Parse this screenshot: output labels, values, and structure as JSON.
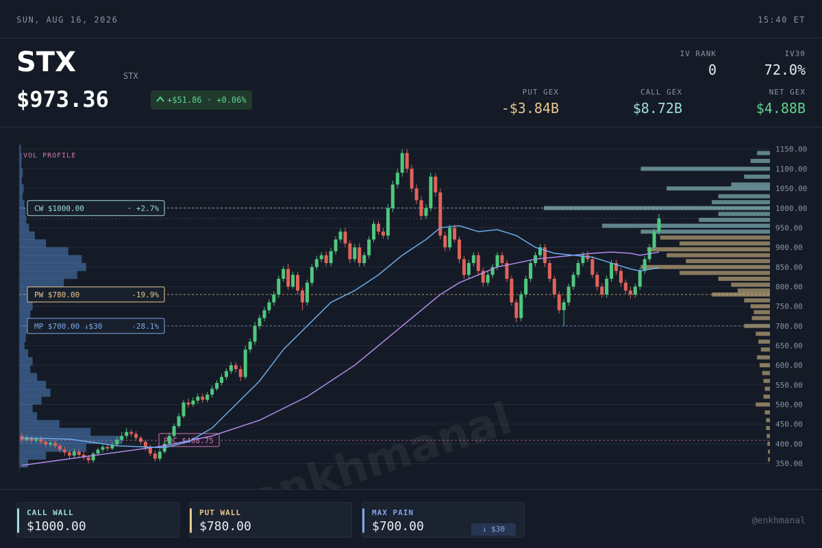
{
  "topbar": {
    "date": "SUN, AUG 16, 2026",
    "time": "15:40 ET"
  },
  "header": {
    "ticker": "STX",
    "ticker_small": "STX",
    "price": "$973.36",
    "change": "+$51.86 · +0.06%",
    "iv_rank_label": "IV RANK",
    "iv_rank_value": "0",
    "iv30_label": "IV30",
    "iv30_value": "72.0%",
    "put_gex_label": "PUT GEX",
    "put_gex_value": "-$3.84B",
    "call_gex_label": "CALL GEX",
    "call_gex_value": "$8.72B",
    "net_gex_label": "NET GEX",
    "net_gex_value": "$4.88B"
  },
  "colors": {
    "up": "#4fc77e",
    "down": "#e0625a",
    "call": "#9fdde0",
    "put": "#e7c98d",
    "maxpain": "#7fa7e8",
    "poc": "#d179b8",
    "ma_fast": "#6aaef0",
    "ma_slow": "#b38df0"
  },
  "chart_data": {
    "type": "candlestick",
    "title": "",
    "vol_profile_label": "VOL PROFILE",
    "watermark": "@enkhmanal",
    "ylim": [
      330,
      1160
    ],
    "y_ticks": [
      "1150.00",
      "1100.00",
      "1050.00",
      "1000.00",
      "950.00",
      "900.00",
      "850.00",
      "800.00",
      "750.00",
      "700.00",
      "650.00",
      "600.00",
      "550.00",
      "500.00",
      "450.00",
      "400.00",
      "350.00"
    ],
    "levels": [
      {
        "name": "CW",
        "label": "CW $1000.00",
        "pct": "· +2.7%",
        "value": 1000,
        "color_key": "call"
      },
      {
        "name": "PW",
        "label": "PW $780.00",
        "pct": "-19.9%",
        "value": 780,
        "color_key": "put"
      },
      {
        "name": "MP",
        "label": "MP $700.00 ↓$30",
        "pct": "-28.1%",
        "value": 700,
        "color_key": "maxpain"
      },
      {
        "name": "POC",
        "label": "POC $408.75",
        "pct": "",
        "value": 408.75,
        "color_key": "poc"
      }
    ],
    "candles": [
      [
        420,
        410,
        428,
        402
      ],
      [
        410,
        415,
        422,
        404
      ],
      [
        415,
        408,
        420,
        400
      ],
      [
        408,
        412,
        418,
        402
      ],
      [
        412,
        405,
        420,
        398
      ],
      [
        405,
        398,
        410,
        390
      ],
      [
        398,
        402,
        408,
        392
      ],
      [
        402,
        395,
        410,
        388
      ],
      [
        395,
        385,
        400,
        378
      ],
      [
        385,
        378,
        392,
        370
      ],
      [
        378,
        370,
        385,
        362
      ],
      [
        370,
        380,
        388,
        365
      ],
      [
        380,
        372,
        386,
        366
      ],
      [
        372,
        365,
        380,
        358
      ],
      [
        365,
        358,
        372,
        350
      ],
      [
        358,
        375,
        380,
        352
      ],
      [
        375,
        385,
        390,
        370
      ],
      [
        385,
        392,
        398,
        378
      ],
      [
        392,
        388,
        400,
        382
      ],
      [
        388,
        398,
        405,
        384
      ],
      [
        398,
        410,
        418,
        392
      ],
      [
        410,
        420,
        430,
        404
      ],
      [
        420,
        430,
        440,
        412
      ],
      [
        430,
        425,
        436,
        418
      ],
      [
        425,
        415,
        432,
        408
      ],
      [
        415,
        405,
        420,
        398
      ],
      [
        405,
        390,
        410,
        382
      ],
      [
        390,
        375,
        398,
        368
      ],
      [
        375,
        362,
        382,
        355
      ],
      [
        362,
        380,
        388,
        356
      ],
      [
        380,
        400,
        408,
        375
      ],
      [
        400,
        420,
        428,
        395
      ],
      [
        420,
        445,
        452,
        415
      ],
      [
        445,
        470,
        478,
        440
      ],
      [
        470,
        505,
        512,
        465
      ],
      [
        505,
        500,
        515,
        492
      ],
      [
        500,
        510,
        518,
        494
      ],
      [
        510,
        520,
        528,
        502
      ],
      [
        520,
        512,
        528,
        505
      ],
      [
        512,
        525,
        532,
        506
      ],
      [
        525,
        540,
        548,
        518
      ],
      [
        540,
        555,
        562,
        535
      ],
      [
        555,
        570,
        578,
        548
      ],
      [
        570,
        585,
        592,
        562
      ],
      [
        585,
        600,
        608,
        578
      ],
      [
        600,
        590,
        608,
        582
      ],
      [
        590,
        570,
        598,
        560
      ],
      [
        570,
        640,
        650,
        565
      ],
      [
        640,
        660,
        668,
        632
      ],
      [
        660,
        700,
        710,
        652
      ],
      [
        700,
        720,
        728,
        692
      ],
      [
        720,
        740,
        748,
        712
      ],
      [
        740,
        760,
        768,
        732
      ],
      [
        760,
        780,
        788,
        752
      ],
      [
        780,
        820,
        828,
        772
      ],
      [
        820,
        845,
        852,
        812
      ],
      [
        845,
        800,
        858,
        792
      ],
      [
        800,
        830,
        838,
        795
      ],
      [
        830,
        790,
        838,
        780
      ],
      [
        790,
        760,
        798,
        740
      ],
      [
        760,
        810,
        818,
        752
      ],
      [
        810,
        850,
        858,
        802
      ],
      [
        850,
        870,
        878,
        842
      ],
      [
        870,
        880,
        888,
        862
      ],
      [
        880,
        860,
        890,
        852
      ],
      [
        860,
        890,
        898,
        852
      ],
      [
        890,
        920,
        928,
        882
      ],
      [
        920,
        940,
        948,
        912
      ],
      [
        940,
        910,
        950,
        900
      ],
      [
        910,
        870,
        918,
        860
      ],
      [
        870,
        900,
        908,
        862
      ],
      [
        900,
        860,
        910,
        850
      ],
      [
        860,
        880,
        888,
        852
      ],
      [
        880,
        920,
        928,
        872
      ],
      [
        920,
        960,
        968,
        912
      ],
      [
        960,
        940,
        968,
        932
      ],
      [
        940,
        930,
        950,
        922
      ],
      [
        930,
        1000,
        1010,
        920
      ],
      [
        1000,
        1060,
        1070,
        990
      ],
      [
        1060,
        1090,
        1100,
        1050
      ],
      [
        1090,
        1140,
        1150,
        1080
      ],
      [
        1140,
        1100,
        1150,
        1090
      ],
      [
        1100,
        1050,
        1110,
        1040
      ],
      [
        1050,
        1020,
        1060,
        1010
      ],
      [
        1020,
        980,
        1030,
        970
      ],
      [
        980,
        1000,
        1010,
        972
      ],
      [
        1000,
        1080,
        1090,
        992
      ],
      [
        1080,
        1040,
        1088,
        1030
      ],
      [
        1040,
        930,
        1050,
        920
      ],
      [
        930,
        900,
        940,
        890
      ],
      [
        900,
        950,
        958,
        892
      ],
      [
        950,
        920,
        958,
        912
      ],
      [
        920,
        870,
        928,
        860
      ],
      [
        870,
        830,
        878,
        820
      ],
      [
        830,
        860,
        868,
        822
      ],
      [
        860,
        880,
        888,
        852
      ],
      [
        880,
        840,
        888,
        832
      ],
      [
        840,
        810,
        848,
        800
      ],
      [
        810,
        830,
        838,
        802
      ],
      [
        830,
        850,
        858,
        822
      ],
      [
        850,
        880,
        888,
        842
      ],
      [
        880,
        860,
        888,
        852
      ],
      [
        860,
        820,
        868,
        812
      ],
      [
        820,
        760,
        828,
        752
      ],
      [
        760,
        720,
        768,
        710
      ],
      [
        720,
        780,
        788,
        712
      ],
      [
        780,
        820,
        828,
        772
      ],
      [
        820,
        860,
        868,
        812
      ],
      [
        860,
        880,
        888,
        852
      ],
      [
        880,
        900,
        908,
        872
      ],
      [
        900,
        860,
        908,
        850
      ],
      [
        860,
        820,
        868,
        812
      ],
      [
        820,
        780,
        828,
        772
      ],
      [
        780,
        740,
        788,
        732
      ],
      [
        740,
        760,
        768,
        700
      ],
      [
        760,
        800,
        808,
        752
      ],
      [
        800,
        830,
        838,
        792
      ],
      [
        830,
        860,
        868,
        822
      ],
      [
        860,
        880,
        888,
        852
      ],
      [
        880,
        870,
        890,
        862
      ],
      [
        870,
        830,
        878,
        822
      ],
      [
        830,
        800,
        838,
        790
      ],
      [
        800,
        780,
        808,
        772
      ],
      [
        780,
        820,
        828,
        772
      ],
      [
        820,
        860,
        868,
        812
      ],
      [
        860,
        840,
        868,
        830
      ],
      [
        840,
        810,
        848,
        800
      ],
      [
        810,
        790,
        818,
        782
      ],
      [
        790,
        780,
        800,
        770
      ],
      [
        780,
        800,
        808,
        772
      ],
      [
        800,
        840,
        848,
        792
      ],
      [
        840,
        870,
        878,
        832
      ],
      [
        870,
        900,
        908,
        862
      ],
      [
        900,
        940,
        948,
        892
      ],
      [
        940,
        973.36,
        985,
        932
      ]
    ],
    "ma_fast": [
      [
        0,
        415
      ],
      [
        10,
        412
      ],
      [
        20,
        395
      ],
      [
        30,
        390
      ],
      [
        35,
        405
      ],
      [
        40,
        440
      ],
      [
        45,
        500
      ],
      [
        50,
        560
      ],
      [
        55,
        640
      ],
      [
        60,
        700
      ],
      [
        65,
        760
      ],
      [
        70,
        790
      ],
      [
        75,
        830
      ],
      [
        80,
        880
      ],
      [
        85,
        920
      ],
      [
        88,
        950
      ],
      [
        92,
        955
      ],
      [
        96,
        940
      ],
      [
        100,
        945
      ],
      [
        104,
        930
      ],
      [
        108,
        900
      ],
      [
        112,
        885
      ],
      [
        116,
        880
      ],
      [
        120,
        875
      ],
      [
        124,
        860
      ],
      [
        128,
        845
      ],
      [
        130,
        840
      ],
      [
        134,
        848
      ]
    ],
    "ma_slow": [
      [
        0,
        345
      ],
      [
        15,
        370
      ],
      [
        30,
        395
      ],
      [
        40,
        420
      ],
      [
        50,
        460
      ],
      [
        60,
        520
      ],
      [
        70,
        600
      ],
      [
        80,
        700
      ],
      [
        88,
        780
      ],
      [
        92,
        810
      ],
      [
        96,
        830
      ],
      [
        100,
        850
      ],
      [
        104,
        860
      ],
      [
        108,
        870
      ],
      [
        112,
        875
      ],
      [
        116,
        880
      ],
      [
        120,
        885
      ],
      [
        124,
        888
      ],
      [
        128,
        885
      ],
      [
        130,
        880
      ],
      [
        134,
        888
      ]
    ],
    "vol_profile_left": [
      [
        1150,
        4
      ],
      [
        1130,
        6
      ],
      [
        1110,
        5
      ],
      [
        1090,
        8
      ],
      [
        1070,
        6
      ],
      [
        1050,
        10
      ],
      [
        1030,
        8
      ],
      [
        1010,
        12
      ],
      [
        990,
        14
      ],
      [
        970,
        16
      ],
      [
        950,
        22
      ],
      [
        930,
        35
      ],
      [
        910,
        60
      ],
      [
        890,
        110
      ],
      [
        870,
        140
      ],
      [
        850,
        150
      ],
      [
        830,
        130
      ],
      [
        810,
        100
      ],
      [
        790,
        60
      ],
      [
        770,
        40
      ],
      [
        750,
        30
      ],
      [
        730,
        25
      ],
      [
        710,
        20
      ],
      [
        690,
        18
      ],
      [
        670,
        15
      ],
      [
        650,
        12
      ],
      [
        630,
        20
      ],
      [
        610,
        30
      ],
      [
        590,
        25
      ],
      [
        570,
        40
      ],
      [
        550,
        60
      ],
      [
        530,
        70
      ],
      [
        510,
        50
      ],
      [
        490,
        30
      ],
      [
        470,
        40
      ],
      [
        450,
        90
      ],
      [
        430,
        160
      ],
      [
        410,
        230
      ],
      [
        390,
        150
      ],
      [
        370,
        60
      ],
      [
        350,
        20
      ]
    ],
    "vol_profile_right": [
      [
        1140,
        20,
        "call"
      ],
      [
        1120,
        30,
        "call"
      ],
      [
        1100,
        200,
        "call"
      ],
      [
        1080,
        40,
        "call"
      ],
      [
        1060,
        60,
        "call"
      ],
      [
        1050,
        160,
        "call"
      ],
      [
        1030,
        80,
        "call"
      ],
      [
        1015,
        90,
        "call"
      ],
      [
        1000,
        350,
        "call"
      ],
      [
        985,
        80,
        "call"
      ],
      [
        970,
        110,
        "call"
      ],
      [
        955,
        260,
        "call"
      ],
      [
        940,
        200,
        "call"
      ],
      [
        925,
        170,
        "put"
      ],
      [
        910,
        140,
        "put"
      ],
      [
        895,
        190,
        "put"
      ],
      [
        880,
        160,
        "put"
      ],
      [
        865,
        130,
        "put"
      ],
      [
        850,
        200,
        "put"
      ],
      [
        835,
        140,
        "put"
      ],
      [
        820,
        80,
        "put"
      ],
      [
        805,
        60,
        "put"
      ],
      [
        790,
        50,
        "put"
      ],
      [
        780,
        90,
        "put"
      ],
      [
        765,
        40,
        "put"
      ],
      [
        750,
        30,
        "put"
      ],
      [
        735,
        25,
        "put"
      ],
      [
        720,
        28,
        "put"
      ],
      [
        700,
        40,
        "put"
      ],
      [
        680,
        22,
        "put"
      ],
      [
        660,
        18,
        "put"
      ],
      [
        640,
        14,
        "put"
      ],
      [
        620,
        20,
        "put"
      ],
      [
        600,
        16,
        "put"
      ],
      [
        580,
        12,
        "put"
      ],
      [
        560,
        10,
        "put"
      ],
      [
        540,
        8,
        "put"
      ],
      [
        520,
        10,
        "put"
      ],
      [
        500,
        22,
        "put"
      ],
      [
        480,
        8,
        "put"
      ],
      [
        460,
        6,
        "put"
      ],
      [
        440,
        6,
        "put"
      ],
      [
        420,
        5,
        "put"
      ],
      [
        400,
        4,
        "put"
      ],
      [
        380,
        3,
        "put"
      ],
      [
        360,
        3,
        "put"
      ]
    ]
  },
  "footer": {
    "call_wall_label": "CALL WALL",
    "call_wall_value": "$1000.00",
    "put_wall_label": "PUT WALL",
    "put_wall_value": "$780.00",
    "max_pain_label": "MAX PAIN",
    "max_pain_value": "$700.00",
    "max_pain_tag": "↓ $30",
    "handle": "@enkhmanal"
  }
}
